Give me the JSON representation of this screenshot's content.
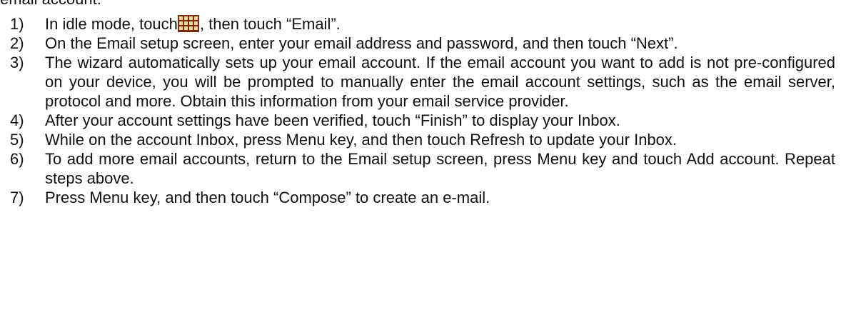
{
  "intro": "email account.",
  "steps": [
    {
      "num": "1)",
      "before": "In idle mode, touch",
      "icon": "app-grid-icon",
      "after": ", then touch “Email”."
    },
    {
      "num": "2)",
      "text": "On the Email setup screen, enter your email address and password, and then touch “Next”."
    },
    {
      "num": "3)",
      "text": "The wizard automatically sets up your email account. If the email account you want to add is not pre-configured on your device, you will be prompted to manually enter the email account settings, such as the email server, protocol and more. Obtain this information from your email service provider."
    },
    {
      "num": "4)",
      "text": "After your account settings have been verified, touch “Finish” to display your Inbox."
    },
    {
      "num": "5)",
      "text": "While on the account Inbox, press Menu key, and then touch Refresh to update your Inbox."
    },
    {
      "num": "6)",
      "text": "To add more email accounts, return to the Email setup screen, press Menu key and touch Add account. Repeat steps above."
    },
    {
      "num": "7)",
      "text": "Press Menu key, and then touch “Compose” to create an e-mail."
    }
  ],
  "colors": {
    "text": "#111111",
    "icon_fill": "#7a2a0e",
    "icon_grid": "#f2d9a0"
  }
}
